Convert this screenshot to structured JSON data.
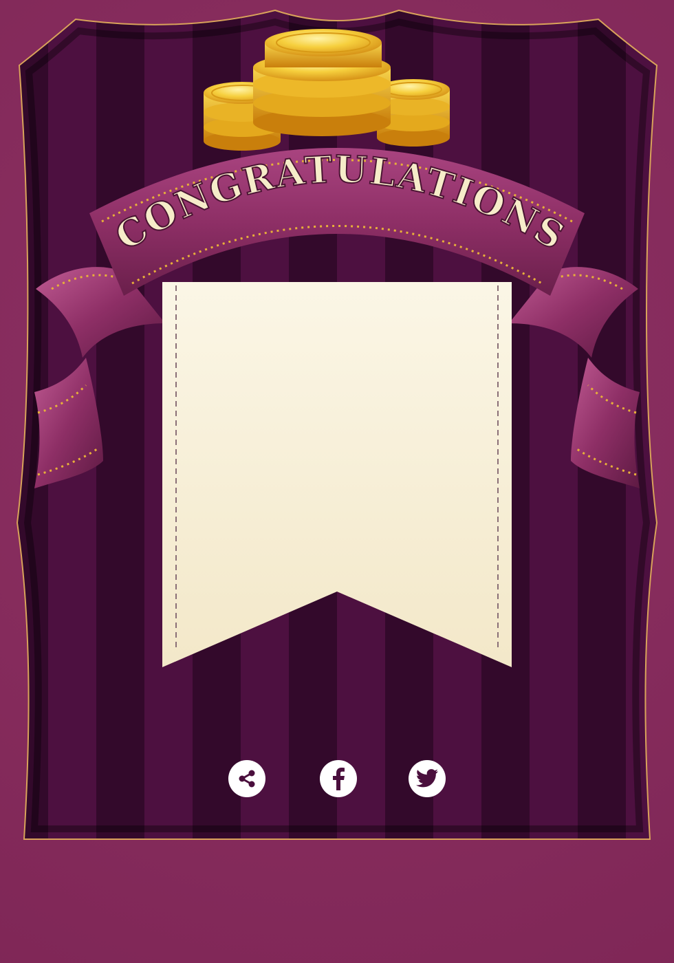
{
  "banner": {
    "title": "CONGRATULATIONS"
  },
  "share": {
    "buttons": [
      {
        "id": "share",
        "icon": "share-icon"
      },
      {
        "id": "facebook",
        "icon": "facebook-icon"
      },
      {
        "id": "twitter",
        "icon": "twitter-icon"
      }
    ]
  },
  "colors": {
    "page_background": "#8a2a5e",
    "stripe_dark": "#2e0a26",
    "stripe_light": "#4a0f3d",
    "frame_border": "#d9a35a",
    "ribbon": "#8e2f66",
    "ribbon_highlight": "#b9528a",
    "ribbon_stitch": "#e8b03a",
    "title_text": "#f6ecc9",
    "parchment": "#f8f1dc",
    "coin": "#f1c232",
    "icon_fill": "#4a0f3d"
  }
}
